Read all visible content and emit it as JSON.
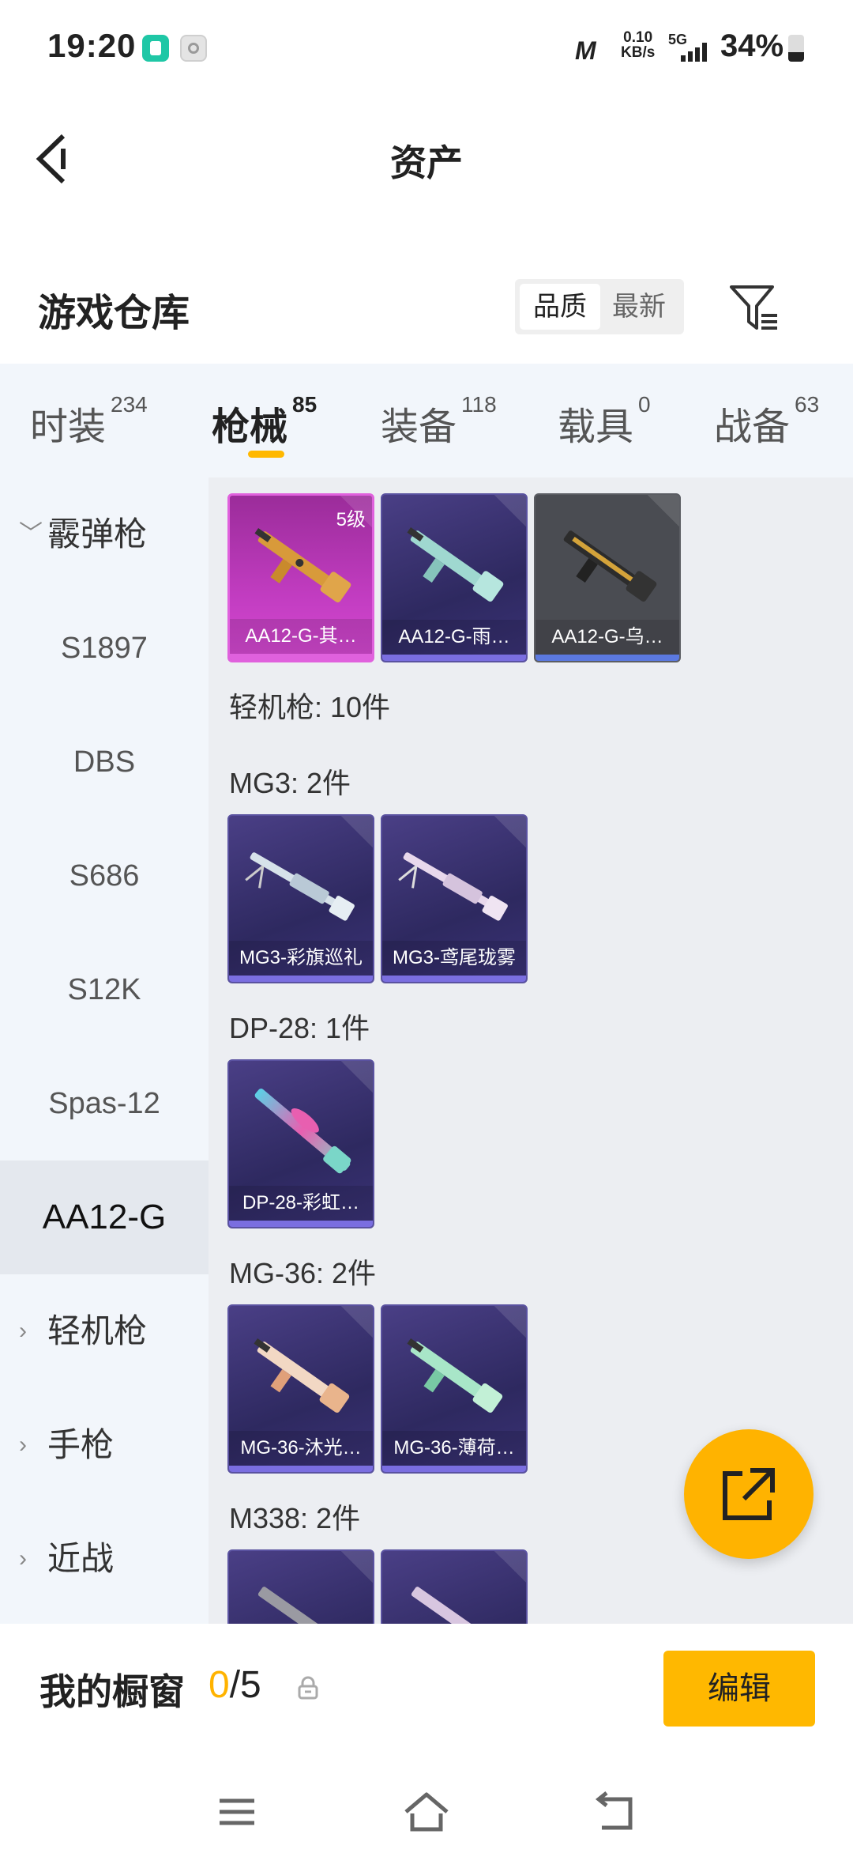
{
  "status_bar": {
    "time": "19:20",
    "carrier_glyph": "M",
    "net_speed_value": "0.10",
    "net_speed_unit": "KB/s",
    "signal_type": "5G",
    "battery": "34%"
  },
  "header": {
    "title": "资产",
    "back_icon": "back-arrow-icon"
  },
  "warehouse": {
    "title": "游戏仓库",
    "sort_options": [
      "品质",
      "最新"
    ],
    "sort_selected": "品质",
    "filter_icon": "filter-icon"
  },
  "tabs": [
    {
      "label": "时装",
      "count": "234"
    },
    {
      "label": "枪械",
      "count": "85",
      "active": true
    },
    {
      "label": "装备",
      "count": "118"
    },
    {
      "label": "载具",
      "count": "0"
    },
    {
      "label": "战备",
      "count": "63"
    }
  ],
  "sidebar": {
    "category_open": "霰弹枪",
    "subitems": [
      "S1897",
      "DBS",
      "S686",
      "S12K",
      "Spas-12",
      "AA12-G"
    ],
    "selected": "AA12-G",
    "categories_collapsed": [
      "轻机枪",
      "手枪",
      "近战"
    ]
  },
  "content": {
    "top_cards": [
      {
        "name": "AA12-G-其…",
        "level": "5级",
        "rarity": "magenta"
      },
      {
        "name": "AA12-G-雨…",
        "rarity": "purple"
      },
      {
        "name": "AA12-G-乌…",
        "rarity": "gray"
      }
    ],
    "lmg_total": "轻机枪: 10件",
    "groups": [
      {
        "title": "MG3: 2件",
        "cards": [
          "MG3-彩旗巡礼",
          "MG3-鸢尾珑雾"
        ]
      },
      {
        "title": "DP-28: 1件",
        "cards": [
          "DP-28-彩虹…"
        ]
      },
      {
        "title": "MG-36: 2件",
        "cards": [
          "MG-36-沐光…",
          "MG-36-薄荷…"
        ]
      },
      {
        "title": "M338: 2件",
        "cards": [
          "",
          ""
        ]
      }
    ]
  },
  "fab": {
    "icon": "share-export-icon"
  },
  "showcase": {
    "label": "我的橱窗",
    "current": "0",
    "total": "/5",
    "lock_icon": "lock-icon",
    "edit_label": "编辑"
  },
  "navbar": {
    "icons": [
      "menu-icon",
      "home-icon",
      "back-icon"
    ]
  },
  "colors": {
    "accent": "#ffb800",
    "sidebar_bg": "#f2f6fb",
    "content_bg": "#eceef2",
    "card_purple": "#2e2960",
    "card_magenta": "#c13cc0",
    "card_gray": "#4a4c52"
  }
}
